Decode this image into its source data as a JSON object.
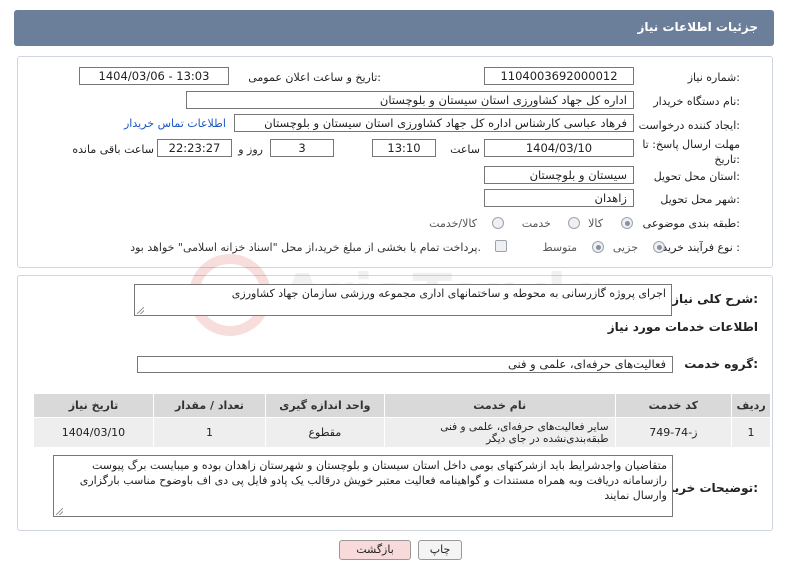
{
  "header": {
    "title": "جزئیات اطلاعات نیاز"
  },
  "fields": {
    "need_number_label": "شماره نیاز:",
    "need_number": "1104003692000012",
    "announce_label": "تاریخ و ساعت اعلان عمومی:",
    "announce_value": "1404/03/06 - 13:03",
    "buyer_org_label": "نام دستگاه خریدار:",
    "buyer_org": "اداره کل جهاد کشاورزی استان سیستان و بلوچستان",
    "creator_label": "ایجاد کننده درخواست:",
    "creator": "فرهاد عباسی کارشناس  اداره کل جهاد کشاورزی استان سیستان و بلوچستان",
    "contact_link": "اطلاعات تماس خریدار",
    "deadline_label": "مهلت ارسال پاسخ: تا تاریخ:",
    "deadline_date": "1404/03/10",
    "time_label": "ساعت",
    "deadline_time": "13:10",
    "days": "3",
    "days_label": "روز و",
    "remaining": "22:23:27",
    "remaining_label": "ساعت باقی مانده",
    "province_label": "استان محل تحویل:",
    "province": "سیستان و بلوچستان",
    "city_label": "شهر محل تحویل:",
    "city": "زاهدان",
    "category_label": "طبقه بندی موضوعی:",
    "category_options": [
      "کالا",
      "خدمت",
      "کالا/خدمت"
    ],
    "process_label": "نوع فرآیند خرید :",
    "process_options": [
      "جزیی",
      "متوسط"
    ],
    "treasury_note": "پرداخت تمام یا بخشی از مبلغ خرید،از محل \"اسناد خزانه اسلامی\" خواهد بود."
  },
  "description": {
    "label": "شرح کلی نیاز:",
    "text": "اجرای پروژه گازرسانی به محوطه و ساختمانهای اداری مجموعه ورزشی سازمان جهاد کشاورزی"
  },
  "services": {
    "section_title": "اطلاعات خدمات مورد نیاز",
    "group_label": "گروه خدمت:",
    "group_value": "فعالیت‌های حرفه‌ای، علمی و فنی",
    "table": {
      "headers": [
        "ردیف",
        "کد خدمت",
        "نام خدمت",
        "واحد اندازه گیری",
        "تعداد / مقدار",
        "تاریخ نیاز"
      ],
      "rows": [
        [
          "1",
          "ز-74-749",
          "سایر فعالیت‌های حرفه‌ای، علمی و فنی طبقه‌بندی‌نشده در جای دیگر",
          "مقطوع",
          "1",
          "1404/03/10"
        ]
      ]
    }
  },
  "buyer_notes": {
    "label": "توضیحات خریدار:",
    "text": "متقاضیان واجدشرایط باید ازشرکتهای بومی داخل استان سیستان و بلوچستان و شهرستان زاهدان بوده و میبایست  برگ پیوست رازسامانه دریافت وبه همراه مستندات و گواهینامه فعالیت معتبر  خویش درقالب یک پادو فایل پی دی اف باوضوح مناسب بارگزاری وارسال نمایند"
  },
  "buttons": {
    "print": "چاپ",
    "back": "بازگشت"
  },
  "watermark": {
    "text": "AriaTender.net"
  },
  "colors": {
    "header_bg": "#6b7e9a",
    "link": "#1a56c4",
    "back_bg": "#f8dada"
  }
}
